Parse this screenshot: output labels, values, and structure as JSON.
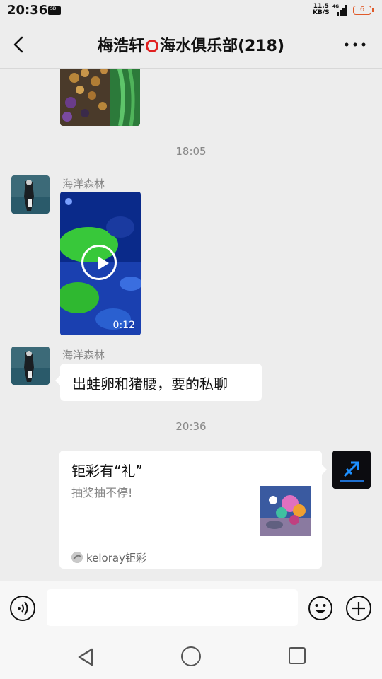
{
  "status_bar": {
    "time": "20:36",
    "sd_label": "SD",
    "net_speed_value": "11.5",
    "net_speed_unit": "KB/S",
    "network": "4G",
    "battery": "6"
  },
  "header": {
    "title_prefix": "梅浩轩",
    "title_suffix": "海水俱乐部(218)"
  },
  "chat": {
    "messages": [
      {
        "type": "image",
        "description": "coral"
      },
      {
        "type": "time",
        "text": "18:05"
      },
      {
        "type": "video",
        "sender": "海洋森林",
        "duration": "0:12"
      },
      {
        "type": "text",
        "sender": "海洋森林",
        "text": "出蛙卵和猪腰，要的私聊"
      },
      {
        "type": "time",
        "text": "20:36"
      },
      {
        "type": "card",
        "title": "钜彩有“礼”",
        "desc": "抽奖抽不停!",
        "source": "keloray钜彩"
      }
    ]
  },
  "input_bar": {
    "value": ""
  },
  "colors": {
    "background": "#ededed",
    "bubble": "#ffffff",
    "accent_red": "#e02020",
    "battery": "#e05a2a"
  }
}
